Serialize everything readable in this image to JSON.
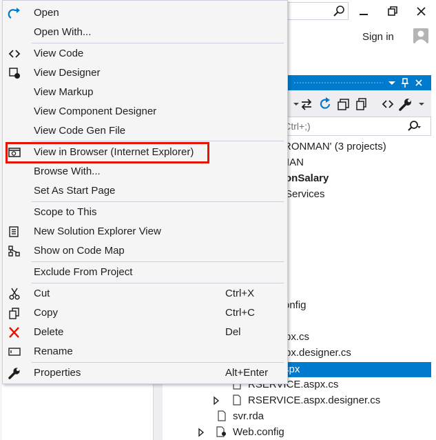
{
  "window": {
    "sign_in": "Sign in",
    "minimize_glyph": "–",
    "restore_glyph": "❐",
    "close_glyph": "✕"
  },
  "solution_explorer": {
    "search_placeholder": "r (Ctrl+;)",
    "pin_glyph": "↕",
    "close_glyph": "✕",
    "tree": [
      "RONMAN' (3 projects)",
      "IAN",
      "onSalary",
      "Services",
      "onfig",
      "px.cs",
      "px.designer.cs",
      "spx",
      "RSERVICE.aspx.cs",
      "RSERVICE.aspx.designer.cs",
      "svr.rda",
      "Web.config"
    ]
  },
  "context_menu": {
    "items": [
      {
        "label": "Open",
        "icon": "redo-arrow-icon"
      },
      {
        "label": "Open With...",
        "icon": ""
      },
      {
        "label": "View Code",
        "icon": "code-brackets-icon"
      },
      {
        "label": "View Designer",
        "icon": "designer-icon"
      },
      {
        "label": "View Markup",
        "icon": ""
      },
      {
        "label": "View Component Designer",
        "icon": ""
      },
      {
        "label": "View Code Gen File",
        "icon": ""
      },
      {
        "label": "View in Browser (Internet Explorer)",
        "icon": "browser-icon"
      },
      {
        "label": "Browse With...",
        "icon": ""
      },
      {
        "label": "Set As Start Page",
        "icon": ""
      },
      {
        "label": "Scope to This",
        "icon": ""
      },
      {
        "label": "New Solution Explorer View",
        "icon": "new-view-icon"
      },
      {
        "label": "Show on Code Map",
        "icon": "code-map-icon"
      },
      {
        "label": "Exclude From Project",
        "icon": ""
      },
      {
        "label": "Cut",
        "shortcut": "Ctrl+X",
        "icon": "scissors-icon"
      },
      {
        "label": "Copy",
        "shortcut": "Ctrl+C",
        "icon": "copy-icon"
      },
      {
        "label": "Delete",
        "shortcut": "Del",
        "icon": "delete-x-icon"
      },
      {
        "label": "Rename",
        "icon": "rename-icon"
      },
      {
        "label": "Properties",
        "shortcut": "Alt+Enter",
        "icon": "wrench-icon"
      }
    ]
  },
  "colors": {
    "accent": "#007acc",
    "highlight_border": "#e51400",
    "delete_icon": "#e51400"
  }
}
